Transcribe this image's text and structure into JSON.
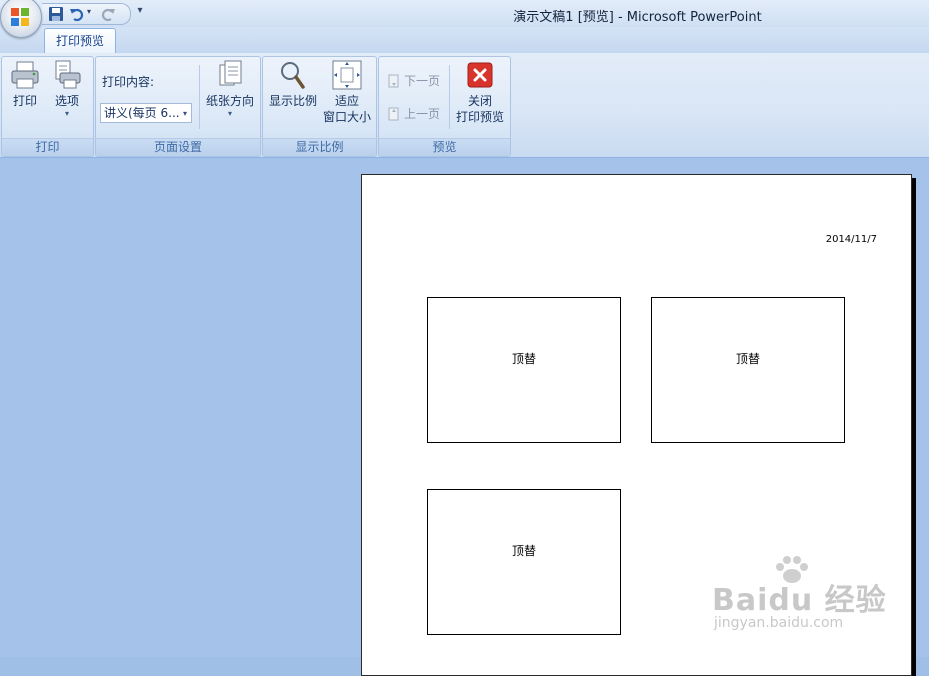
{
  "window": {
    "title": "演示文稿1 [预览] - Microsoft PowerPoint"
  },
  "quick_access": {
    "icons": [
      "save-icon",
      "undo-icon",
      "redo-icon",
      "customize-dropdown-icon"
    ]
  },
  "tabs": [
    {
      "label": "打印预览",
      "active": true
    }
  ],
  "ribbon": {
    "groups": {
      "print": {
        "label": "打印",
        "print_button": "打印",
        "options_button": "选项"
      },
      "page_setup": {
        "label": "页面设置",
        "content_label": "打印内容:",
        "content_value": "讲义(每页 6...",
        "orientation_button": "纸张方向"
      },
      "zoom": {
        "label": "显示比例",
        "zoom_button": "显示比例",
        "fit_button_line1": "适应",
        "fit_button_line2": "窗口大小"
      },
      "preview": {
        "label": "预览",
        "next_page": "下一页",
        "prev_page": "上一页",
        "close_line1": "关闭",
        "close_line2": "打印预览"
      }
    }
  },
  "page": {
    "date": "2014/11/7",
    "slides": [
      {
        "text": "顶替"
      },
      {
        "text": "顶替"
      },
      {
        "text": "顶替"
      }
    ]
  },
  "watermark": {
    "main": "Baidu 经验",
    "sub": "jingyan.baidu.com"
  },
  "colors": {
    "workspace_bg": "#a4c2ea",
    "ribbon_bg": "#dae6f6",
    "group_label": "#3e6aa5",
    "close_red": "#d9342b"
  }
}
